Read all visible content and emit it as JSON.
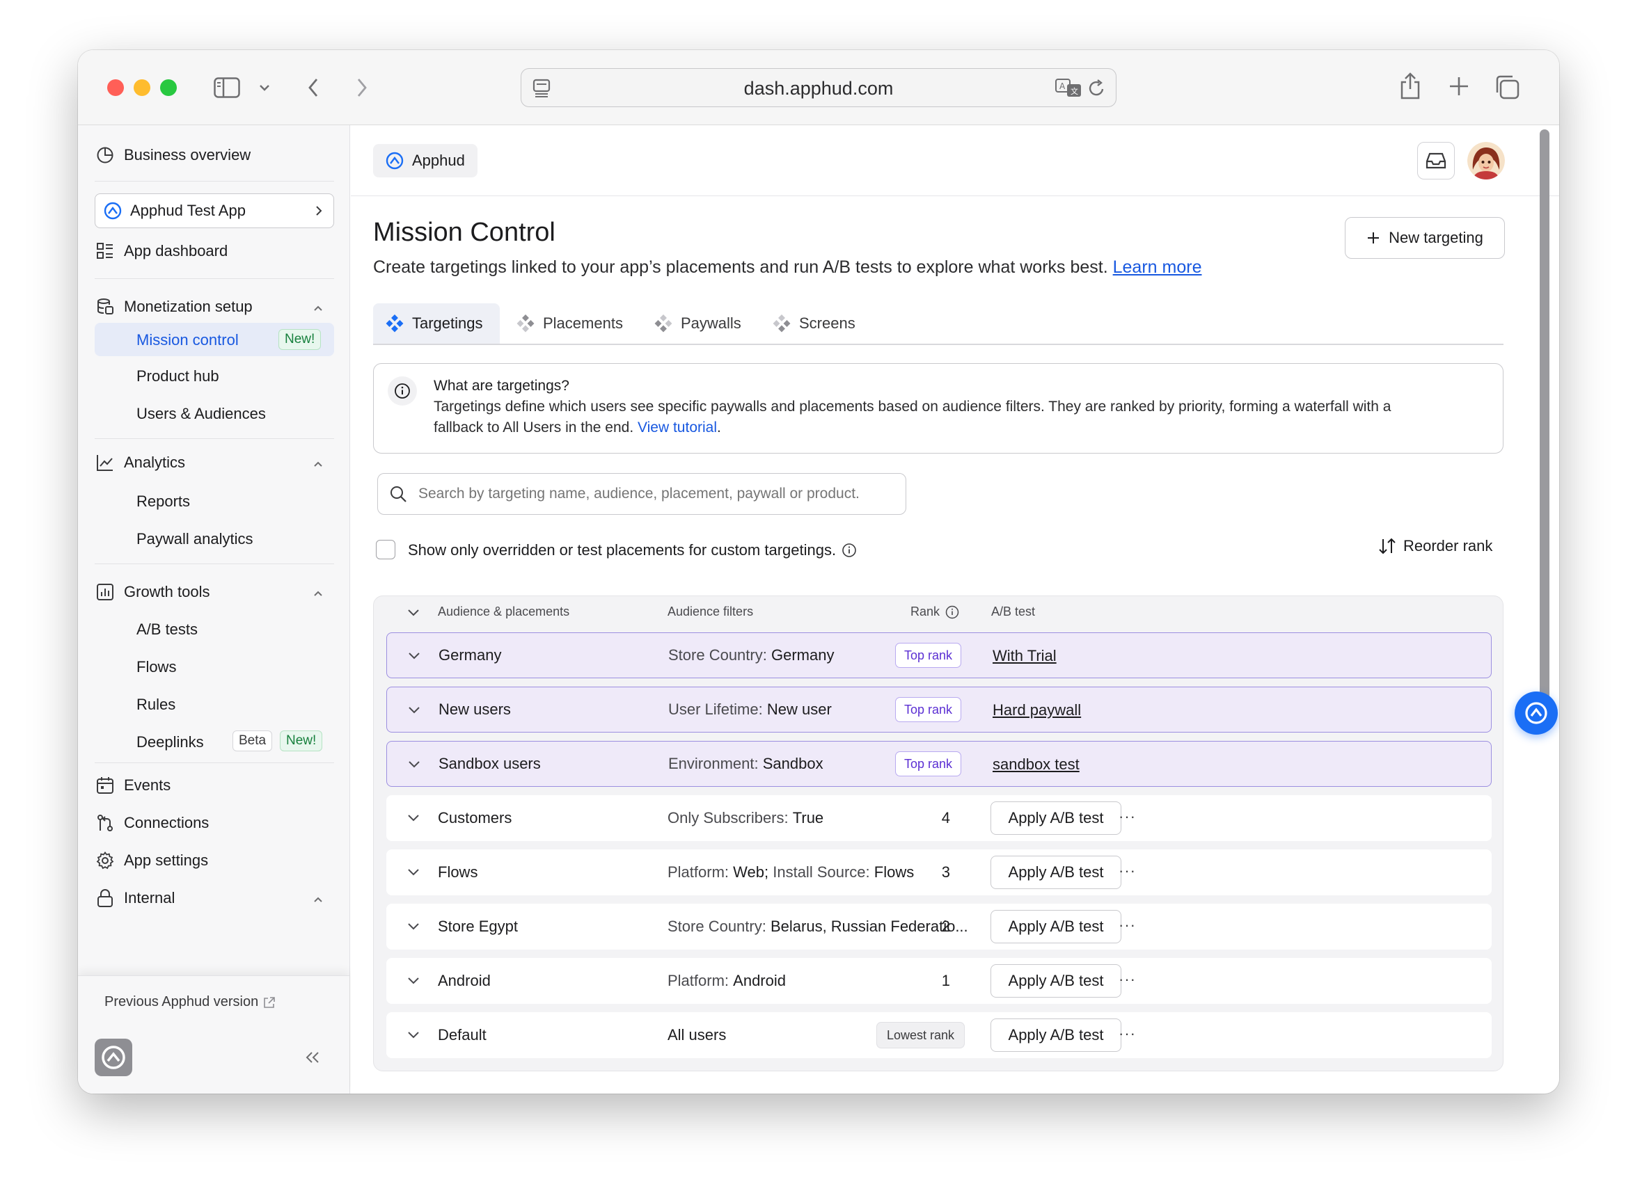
{
  "browser": {
    "url": "dash.apphud.com"
  },
  "sidebar": {
    "business_overview": "Business overview",
    "app_selector": "Apphud Test App",
    "app_dashboard": "App dashboard",
    "monetization": {
      "label": "Monetization setup",
      "items": [
        {
          "label": "Mission control",
          "badge": "New!"
        },
        {
          "label": "Product hub"
        },
        {
          "label": "Users & Audiences"
        }
      ]
    },
    "analytics": {
      "label": "Analytics",
      "items": [
        {
          "label": "Reports"
        },
        {
          "label": "Paywall analytics"
        }
      ]
    },
    "growth": {
      "label": "Growth tools",
      "items": [
        {
          "label": "A/B tests"
        },
        {
          "label": "Flows"
        },
        {
          "label": "Rules"
        },
        {
          "label": "Deeplinks",
          "badge_beta": "Beta",
          "badge_new": "New!"
        }
      ]
    },
    "events": "Events",
    "connections": "Connections",
    "app_settings": "App settings",
    "internal": "Internal",
    "previous_version": "Previous Apphud version"
  },
  "header": {
    "org_chip": "Apphud"
  },
  "main": {
    "title": "Mission Control",
    "description": "Create targetings linked to your app’s placements and run A/B tests to explore what works best.",
    "learn_more": "Learn more",
    "new_targeting": "New targeting",
    "tabs": [
      {
        "label": "Targetings",
        "active": true
      },
      {
        "label": "Placements"
      },
      {
        "label": "Paywalls"
      },
      {
        "label": "Screens"
      }
    ],
    "info": {
      "title": "What are targetings?",
      "body": "Targetings define which users see specific paywalls and placements based on audience filters. They are ranked by priority, forming a waterfall with a",
      "body2": "fallback to All Users in the end.",
      "link": "View tutorial",
      "period": "."
    },
    "search_placeholder": "Search by targeting name, audience, placement, paywall or product.",
    "checkbox_label": "Show only overridden or test placements for custom targetings.",
    "reorder": "Reorder rank"
  },
  "table": {
    "headers": {
      "audience": "Audience & placements",
      "filters": "Audience filters",
      "rank": "Rank",
      "ab": "A/B test"
    },
    "rows": [
      {
        "name": "Germany",
        "filter_k": "Store Country:",
        "filter_v": "Germany",
        "rank": "Top rank",
        "ab": "With Trial"
      },
      {
        "name": "New users",
        "filter_k": "User Lifetime:",
        "filter_v": "New user",
        "rank": "Top rank",
        "ab": "Hard paywall"
      },
      {
        "name": "Sandbox users",
        "filter_k": "Environment:",
        "filter_v": "Sandbox",
        "rank": "Top rank",
        "ab": "sandbox test"
      },
      {
        "name": "Customers",
        "filter_k": "Only Subscribers:",
        "filter_v": "True",
        "rank": "4",
        "ab": "Apply A/B test"
      },
      {
        "name": "Flows",
        "filter_k": "Platform:",
        "filter_v": "Web;",
        "filter_k2": "Install Source:",
        "filter_v2": "Flows",
        "rank": "3",
        "ab": "Apply A/B test"
      },
      {
        "name": "Store Egypt",
        "filter_k": "Store Country:",
        "filter_v": "Belarus, Russian Federatio...",
        "rank": "2",
        "ab": "Apply A/B test"
      },
      {
        "name": "Android",
        "filter_k": "Platform:",
        "filter_v": "Android",
        "rank": "1",
        "ab": "Apply A/B test"
      },
      {
        "name": "Default",
        "filter_v": "All users",
        "rank": "Lowest rank",
        "ab": "Apply A/B test"
      }
    ],
    "more": "···"
  },
  "colors": {
    "accent": "#1858e0",
    "top_rank_text": "#5b2fd3",
    "highlight_row": "#efeaf9",
    "new_badge": "#17803d"
  }
}
